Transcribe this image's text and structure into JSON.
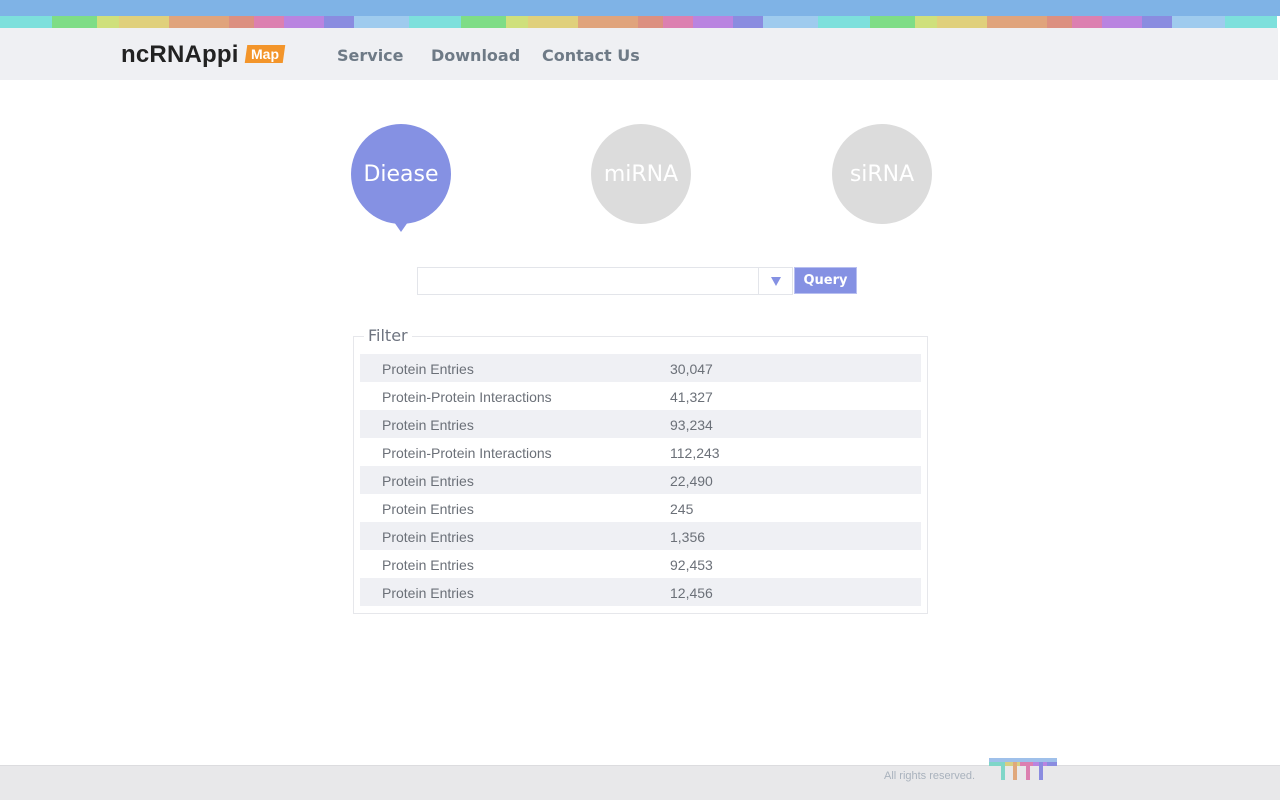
{
  "header": {
    "logo": "ncRNAppi",
    "badge": "Map",
    "nav": {
      "service": "Service",
      "download": "Download",
      "contact": "Contact Us"
    }
  },
  "categories": {
    "disease": "Diease",
    "mirna": "miRNA",
    "sirna": "siRNA",
    "selected": "disease",
    "selected_color": "#8591e3",
    "inactive_color": "#dcdcdc"
  },
  "search": {
    "value": "",
    "placeholder": "",
    "dropdown_icon": "triangle-down-icon",
    "query_label": "Query"
  },
  "filter": {
    "legend": "Filter",
    "rows": [
      {
        "name": "Protein Entries",
        "count": "30,047"
      },
      {
        "name": "Protein-Protein Interactions",
        "count": "41,327"
      },
      {
        "name": "Protein Entries",
        "count": "93,234"
      },
      {
        "name": "Protein-Protein Interactions",
        "count": "112,243"
      },
      {
        "name": "Protein Entries",
        "count": "22,490"
      },
      {
        "name": "Protein Entries",
        "count": "245"
      },
      {
        "name": "Protein Entries",
        "count": "1,356"
      },
      {
        "name": "Protein Entries",
        "count": "92,453"
      },
      {
        "name": "Protein Entries",
        "count": "12,456"
      }
    ]
  },
  "footer": {
    "rights": "All rights reserved."
  },
  "colors": {
    "accent": "#8591e3",
    "badge": "#f3952a",
    "top_bar": "#7fb3e6"
  }
}
